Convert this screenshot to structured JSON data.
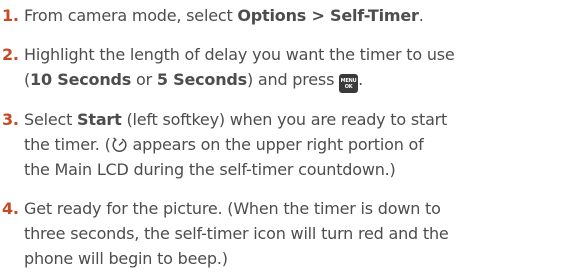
{
  "steps": [
    {
      "number": "1.",
      "lines": [
        {
          "pre": "From camera mode, select ",
          "bold": "Options > Self-Timer",
          "post": "."
        }
      ]
    },
    {
      "number": "2.",
      "line1": "Highlight the length of delay you want the timer to use",
      "line2_pre": "(",
      "bold_a": "10 Seconds",
      "line2_mid": " or ",
      "bold_b": "5 Seconds",
      "line2_post": ") and press ",
      "icon": "menu-ok-key-icon",
      "icon_text_top": "MENU",
      "icon_text_bottom": "OK",
      "line2_end": "."
    },
    {
      "number": "3.",
      "line1_pre": "Select ",
      "line1_bold": "Start",
      "line1_post": " (left softkey) when you are ready to start",
      "line2_pre": "the timer. (",
      "icon": "self-timer-icon",
      "line2_post": " appears on the upper right portion of",
      "line3": "the Main LCD during the self-timer countdown.)"
    },
    {
      "number": "4.",
      "line1": "Get ready for the picture. (When the timer is down to",
      "line2": "three seconds, the self-timer icon will turn red and the",
      "line3": "phone will begin to beep.)"
    }
  ],
  "colors": {
    "step_number": "#c74a25",
    "body_text": "#4d4d4d",
    "icon_bg": "#3a3a3a"
  }
}
